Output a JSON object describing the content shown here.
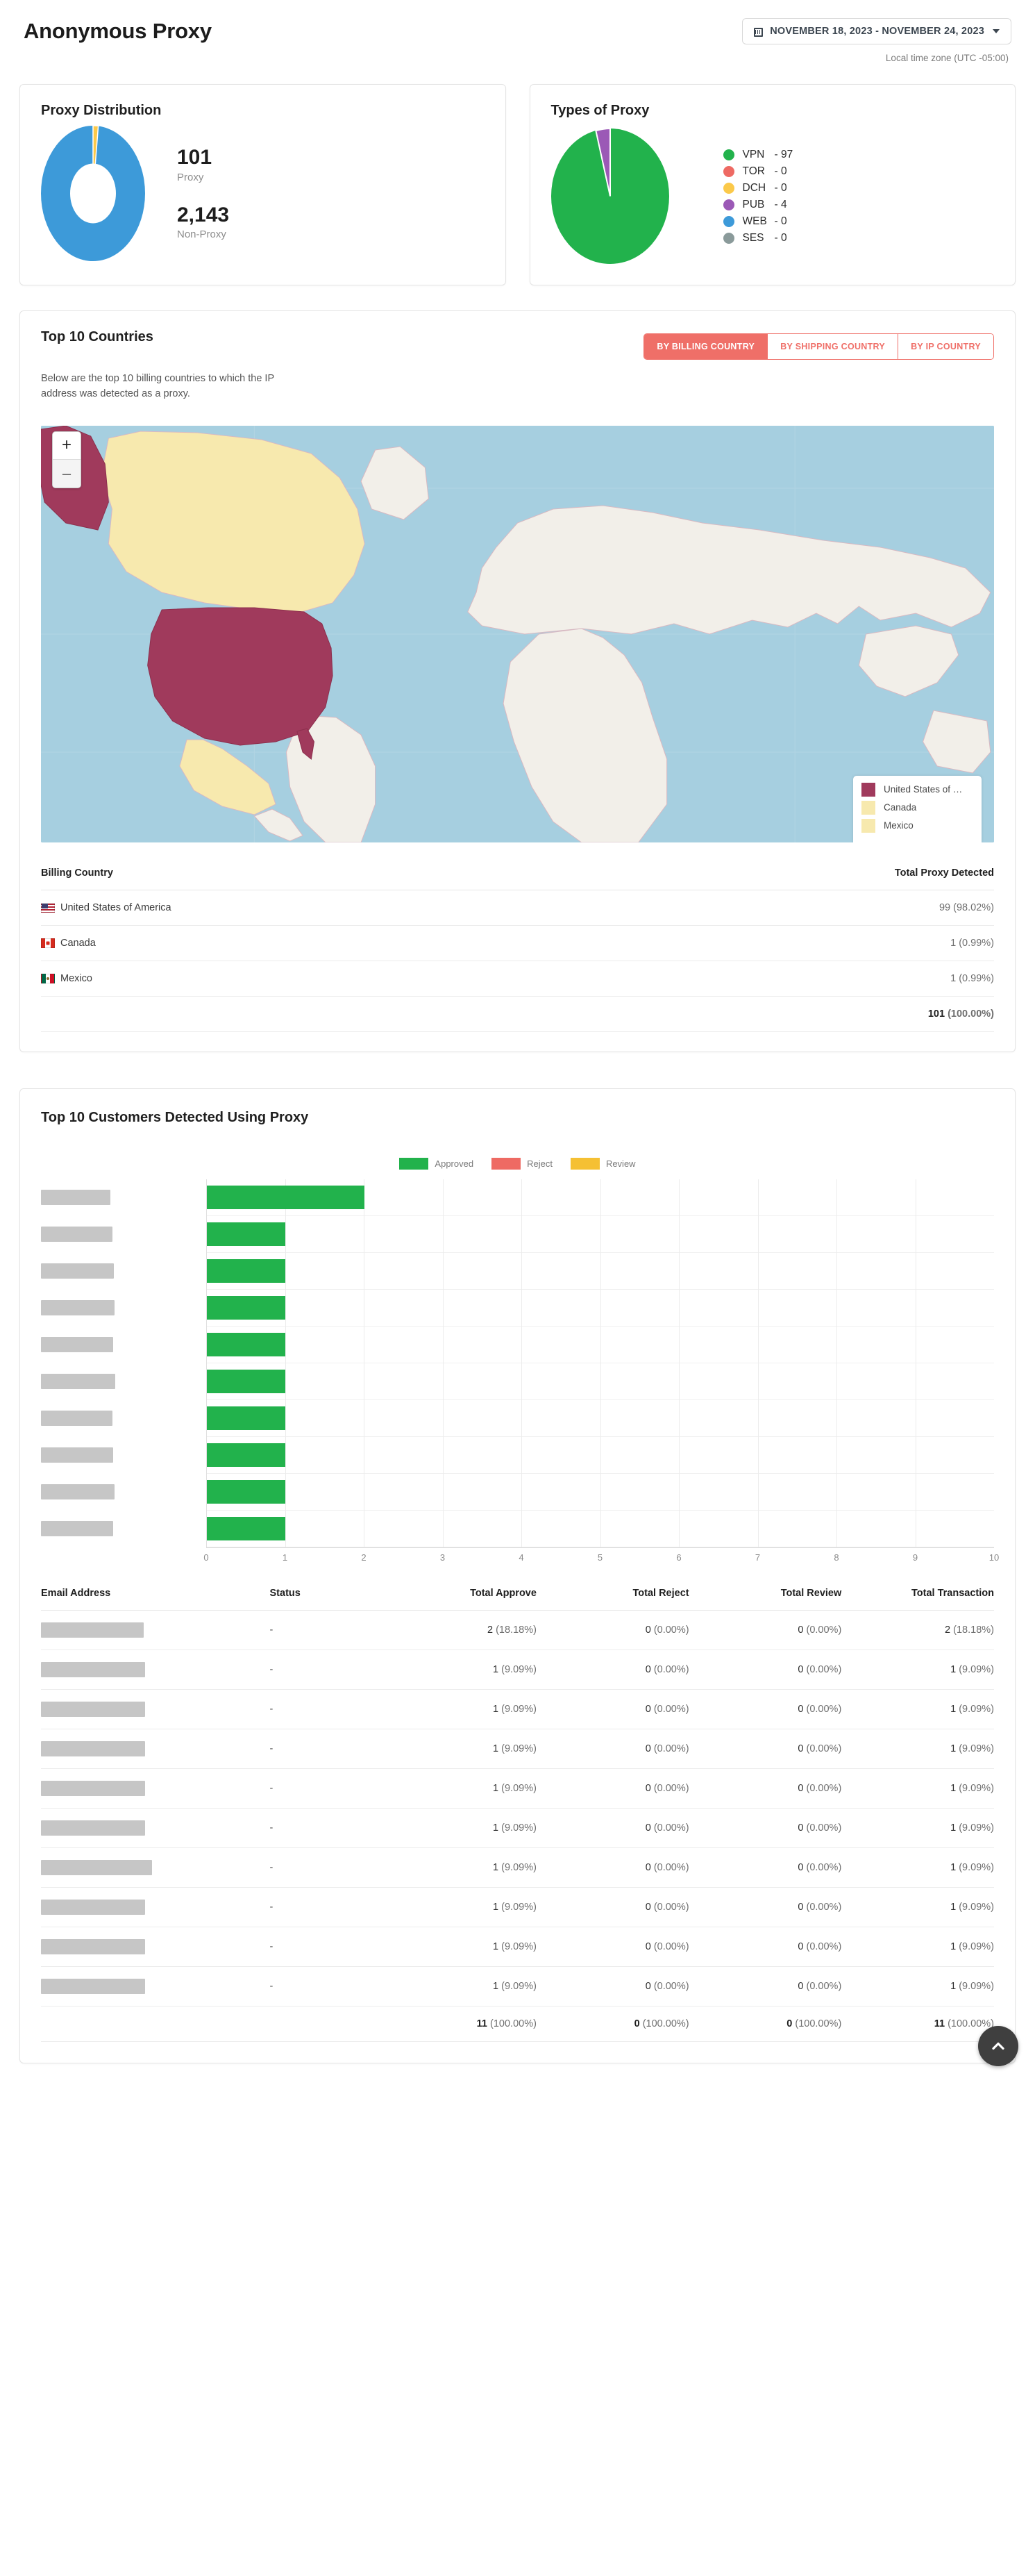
{
  "header": {
    "title": "Anonymous Proxy",
    "date_range": "NOVEMBER 18, 2023 - NOVEMBER 24, 2023",
    "timezone": "Local time zone (UTC -05:00)"
  },
  "proxy_distribution": {
    "title": "Proxy Distribution",
    "proxy_value": "101",
    "proxy_label": "Proxy",
    "nonproxy_value": "2,143",
    "nonproxy_label": "Non-Proxy"
  },
  "types_of_proxy": {
    "title": "Types of Proxy",
    "legend": [
      {
        "name": "VPN",
        "value": "- 97",
        "color": "#22b24c"
      },
      {
        "name": "TOR",
        "value": "- 0",
        "color": "#ee6a63"
      },
      {
        "name": "DCH",
        "value": "- 0",
        "color": "#fbc94a"
      },
      {
        "name": "PUB",
        "value": "- 4",
        "color": "#9b59b6"
      },
      {
        "name": "WEB",
        "value": "- 0",
        "color": "#3d9ad9"
      },
      {
        "name": "SES",
        "value": " - 0",
        "color": "#8a9a9a"
      }
    ]
  },
  "countries": {
    "title": "Top 10 Countries",
    "description": "Below are the top 10 billing countries to which the IP address was detected as a proxy.",
    "tabs": [
      {
        "label": "BY BILLING COUNTRY",
        "active": true
      },
      {
        "label": "BY SHIPPING COUNTRY",
        "active": false
      },
      {
        "label": "BY IP COUNTRY",
        "active": false
      }
    ],
    "map_zoom_in": "+",
    "map_zoom_out": "–",
    "map_legend": [
      {
        "label": "United States of …",
        "color": "#a03a5c"
      },
      {
        "label": "Canada",
        "color": "#f7e9ae"
      },
      {
        "label": "Mexico",
        "color": "#f7e9ae"
      }
    ],
    "table": {
      "headers": [
        "Billing Country",
        "Total Proxy Detected"
      ],
      "rows": [
        {
          "flag": "us",
          "country": "United States of America",
          "count": "99",
          "pct": "(98.02%)"
        },
        {
          "flag": "ca",
          "country": "Canada",
          "count": "1",
          "pct": "(0.99%)"
        },
        {
          "flag": "mx",
          "country": "Mexico",
          "count": "1",
          "pct": "(0.99%)"
        }
      ],
      "total": {
        "count": "101",
        "pct": "(100.00%)"
      }
    }
  },
  "customers": {
    "title": "Top 10 Customers Detected Using Proxy",
    "chart_legend": [
      {
        "label": "Approved",
        "color": "#22b24c"
      },
      {
        "label": "Reject",
        "color": "#ee6a63"
      },
      {
        "label": "Review",
        "color": "#f5c033"
      }
    ],
    "table": {
      "headers": [
        "Email Address",
        "Status",
        "Total Approve",
        "Total Reject",
        "Total Review",
        "Total Transaction"
      ],
      "rows": [
        {
          "email": "",
          "status": "-",
          "approve": "2",
          "approve_pct": "(18.18%)",
          "reject": "0",
          "reject_pct": "(0.00%)",
          "review": "0",
          "review_pct": "(0.00%)",
          "transaction": "2",
          "transaction_pct": "(18.18%)"
        },
        {
          "email": "",
          "status": "-",
          "approve": "1",
          "approve_pct": "(9.09%)",
          "reject": "0",
          "reject_pct": "(0.00%)",
          "review": "0",
          "review_pct": "(0.00%)",
          "transaction": "1",
          "transaction_pct": "(9.09%)"
        },
        {
          "email": "",
          "status": "-",
          "approve": "1",
          "approve_pct": "(9.09%)",
          "reject": "0",
          "reject_pct": "(0.00%)",
          "review": "0",
          "review_pct": "(0.00%)",
          "transaction": "1",
          "transaction_pct": "(9.09%)"
        },
        {
          "email": "",
          "status": "-",
          "approve": "1",
          "approve_pct": "(9.09%)",
          "reject": "0",
          "reject_pct": "(0.00%)",
          "review": "0",
          "review_pct": "(0.00%)",
          "transaction": "1",
          "transaction_pct": "(9.09%)"
        },
        {
          "email": "",
          "status": "-",
          "approve": "1",
          "approve_pct": "(9.09%)",
          "reject": "0",
          "reject_pct": "(0.00%)",
          "review": "0",
          "review_pct": "(0.00%)",
          "transaction": "1",
          "transaction_pct": "(9.09%)"
        },
        {
          "email": "",
          "status": "-",
          "approve": "1",
          "approve_pct": "(9.09%)",
          "reject": "0",
          "reject_pct": "(0.00%)",
          "review": "0",
          "review_pct": "(0.00%)",
          "transaction": "1",
          "transaction_pct": "(9.09%)"
        },
        {
          "email": "",
          "status": "-",
          "approve": "1",
          "approve_pct": "(9.09%)",
          "reject": "0",
          "reject_pct": "(0.00%)",
          "review": "0",
          "review_pct": "(0.00%)",
          "transaction": "1",
          "transaction_pct": "(9.09%)"
        },
        {
          "email": "",
          "status": "-",
          "approve": "1",
          "approve_pct": "(9.09%)",
          "reject": "0",
          "reject_pct": "(0.00%)",
          "review": "0",
          "review_pct": "(0.00%)",
          "transaction": "1",
          "transaction_pct": "(9.09%)"
        },
        {
          "email": "",
          "status": "-",
          "approve": "1",
          "approve_pct": "(9.09%)",
          "reject": "0",
          "reject_pct": "(0.00%)",
          "review": "0",
          "review_pct": "(0.00%)",
          "transaction": "1",
          "transaction_pct": "(9.09%)"
        },
        {
          "email": "",
          "status": "-",
          "approve": "1",
          "approve_pct": "(9.09%)",
          "reject": "0",
          "reject_pct": "(0.00%)",
          "review": "0",
          "review_pct": "(0.00%)",
          "transaction": "1",
          "transaction_pct": "(9.09%)"
        }
      ],
      "total": {
        "approve": "11",
        "approve_pct": "(100.00%)",
        "reject": "0",
        "reject_pct": "(100.00%)",
        "review": "0",
        "review_pct": "(100.00%)",
        "transaction": "11",
        "transaction_pct": "(100.00%)"
      }
    }
  },
  "scroll_top_label": "",
  "chart_data": [
    {
      "type": "pie",
      "title": "Proxy Distribution",
      "variant": "donut",
      "categories": [
        "Proxy",
        "Non-Proxy"
      ],
      "values": [
        101,
        2143
      ],
      "colors": [
        "#fbc94a",
        "#3d9ad9"
      ],
      "legend": "right-stats"
    },
    {
      "type": "pie",
      "title": "Types of Proxy",
      "categories": [
        "VPN",
        "TOR",
        "DCH",
        "PUB",
        "WEB",
        "SES"
      ],
      "values": [
        97,
        0,
        0,
        4,
        0,
        0
      ],
      "colors": [
        "#22b24c",
        "#ee6a63",
        "#fbc94a",
        "#9b59b6",
        "#3d9ad9",
        "#8a9a9a"
      ],
      "legend": "right"
    },
    {
      "type": "bar",
      "orientation": "horizontal",
      "title": "Top 10 Customers Detected Using Proxy",
      "categories": [
        "",
        "",
        "",
        "",
        "",
        "",
        "",
        "",
        "",
        ""
      ],
      "categories_redacted": true,
      "series": [
        {
          "name": "Approved",
          "color": "#22b24c",
          "values": [
            2,
            1,
            1,
            1,
            1,
            1,
            1,
            1,
            1,
            1
          ]
        },
        {
          "name": "Reject",
          "color": "#ee6a63",
          "values": [
            0,
            0,
            0,
            0,
            0,
            0,
            0,
            0,
            0,
            0
          ]
        },
        {
          "name": "Review",
          "color": "#f5c033",
          "values": [
            0,
            0,
            0,
            0,
            0,
            0,
            0,
            0,
            0,
            0
          ]
        }
      ],
      "xlabel": "",
      "ylabel": "",
      "xlim": [
        0,
        10
      ],
      "xticks": [
        "0",
        "1",
        "2",
        "3",
        "4",
        "5",
        "6",
        "7",
        "8",
        "9",
        "10"
      ],
      "grid": true,
      "legend_position": "top-center"
    },
    {
      "type": "table",
      "title": "Top 10 Countries — Billing Country",
      "columns": [
        "Billing Country",
        "Total Proxy Detected"
      ],
      "rows": [
        [
          "United States of America",
          "99 (98.02%)"
        ],
        [
          "Canada",
          "1 (0.99%)"
        ],
        [
          "Mexico",
          "1 (0.99%)"
        ]
      ],
      "total": [
        "",
        "101 (100.00%)"
      ]
    }
  ]
}
